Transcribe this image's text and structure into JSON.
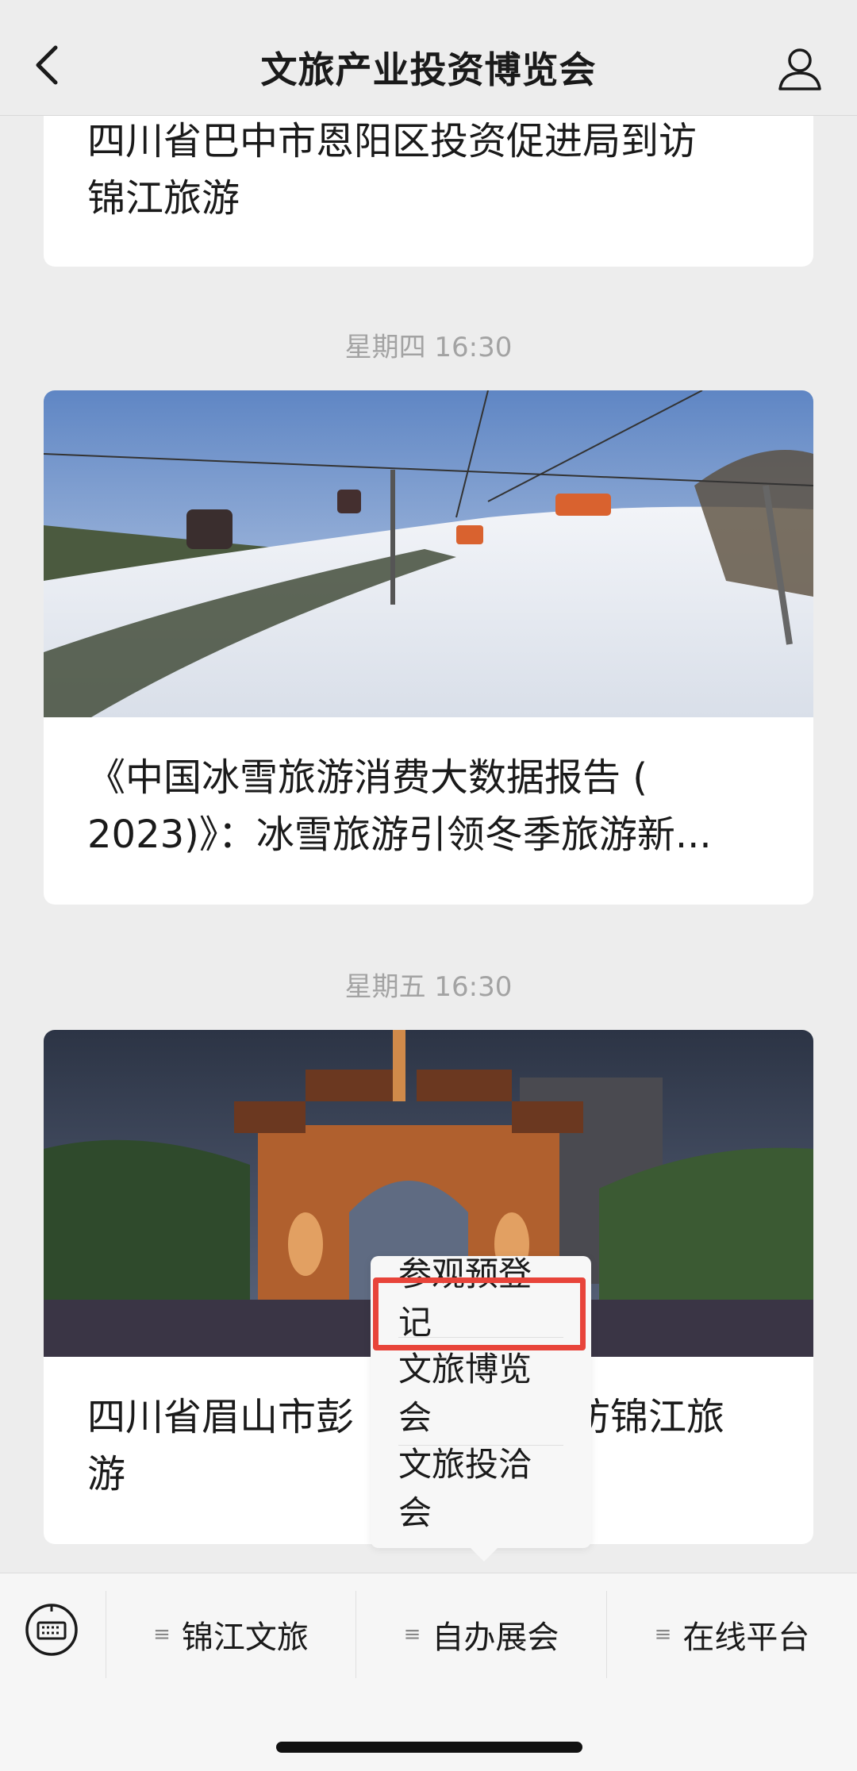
{
  "header": {
    "title": "文旅产业投资博览会"
  },
  "messages": [
    {
      "title": "四川省巴中市恩阳区投资促进局到访\n锦江旅游"
    },
    {
      "time": "星期四 16:30",
      "title": "《中国冰雪旅游消费大数据报告 (\n2023)》：冰雪旅游引领冬季旅游新..."
    },
    {
      "time": "星期五 16:30",
      "title_left": "四川省眉山市彭",
      "title_right": "访锦江旅",
      "title_line2": "游"
    }
  ],
  "popup": {
    "items": [
      "参观预登记",
      "文旅博览会",
      "文旅投洽会"
    ]
  },
  "bottom_menu": {
    "items": [
      "锦江文旅",
      "自办展会",
      "在线平台"
    ]
  },
  "colors": {
    "highlight": "#e8443a",
    "background": "#ededed"
  }
}
